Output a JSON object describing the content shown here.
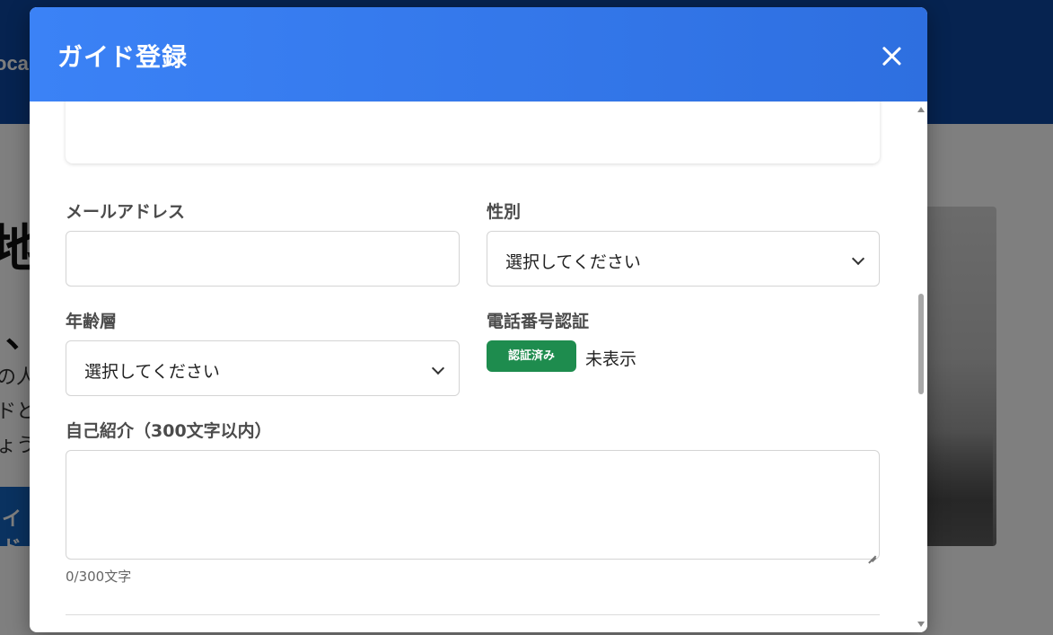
{
  "background": {
    "logo_fragment": "oca",
    "heading_fragment": "地域",
    "heading2_fragment": "、",
    "text_lines": [
      "の人",
      "ドと",
      "ょう"
    ],
    "button_fragment": "イド"
  },
  "modal": {
    "title": "ガイド登録",
    "close_icon": "close-icon",
    "email": {
      "label": "メールアドレス",
      "value": "",
      "placeholder": ""
    },
    "gender": {
      "label": "性別",
      "selected": "選択してください"
    },
    "age_group": {
      "label": "年齢層",
      "selected": "選択してください"
    },
    "phone_verification": {
      "label": "電話番号認証",
      "badge": "認証済み",
      "status": "未表示"
    },
    "self_intro": {
      "label": "自己紹介（300文字以内）",
      "value": "",
      "char_count": "0/300文字"
    }
  },
  "colors": {
    "header_gradient_start": "#3b82f6",
    "header_gradient_end": "#2e6fe0",
    "badge_green": "#1e8c4e"
  }
}
